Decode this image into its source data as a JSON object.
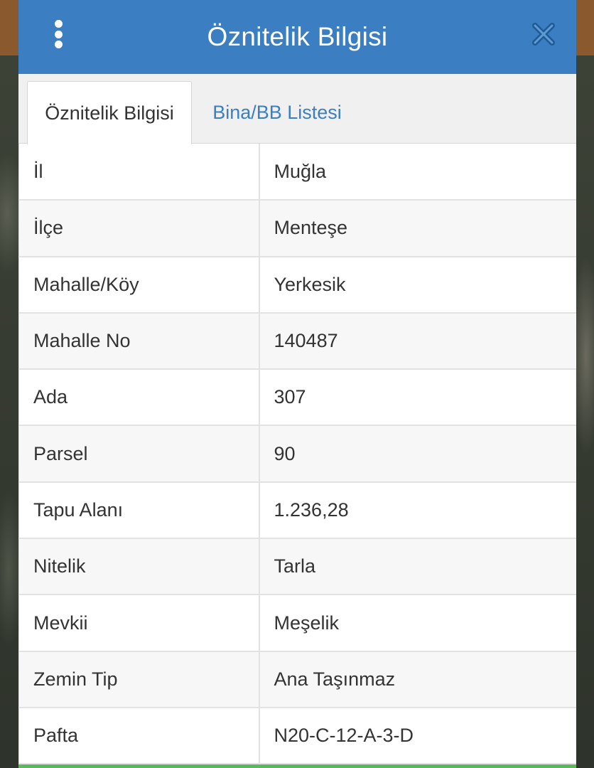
{
  "header": {
    "title": "Öznitelik Bilgisi"
  },
  "tabs": [
    {
      "label": "Öznitelik Bilgisi",
      "active": true
    },
    {
      "label": "Bina/BB Listesi",
      "active": false
    }
  ],
  "rows": [
    {
      "key": "İl",
      "value": "Muğla"
    },
    {
      "key": "İlçe",
      "value": "Menteşe"
    },
    {
      "key": "Mahalle/Köy",
      "value": "Yerkesik"
    },
    {
      "key": "Mahalle No",
      "value": "140487"
    },
    {
      "key": "Ada",
      "value": "307"
    },
    {
      "key": "Parsel",
      "value": "90"
    },
    {
      "key": "Tapu Alanı",
      "value": "1.236,28"
    },
    {
      "key": "Nitelik",
      "value": "Tarla"
    },
    {
      "key": "Mevkii",
      "value": "Meşelik"
    },
    {
      "key": "Zemin Tip",
      "value": "Ana Taşınmaz"
    },
    {
      "key": "Pafta",
      "value": "N20-C-12-A-3-D"
    }
  ],
  "colors": {
    "header_bg": "#3b7fc2",
    "tab_link": "#3b7fc2",
    "bottom_accent": "#5cb85c"
  },
  "icons": {
    "menu": "vertical-dots-icon",
    "close": "close-icon"
  }
}
